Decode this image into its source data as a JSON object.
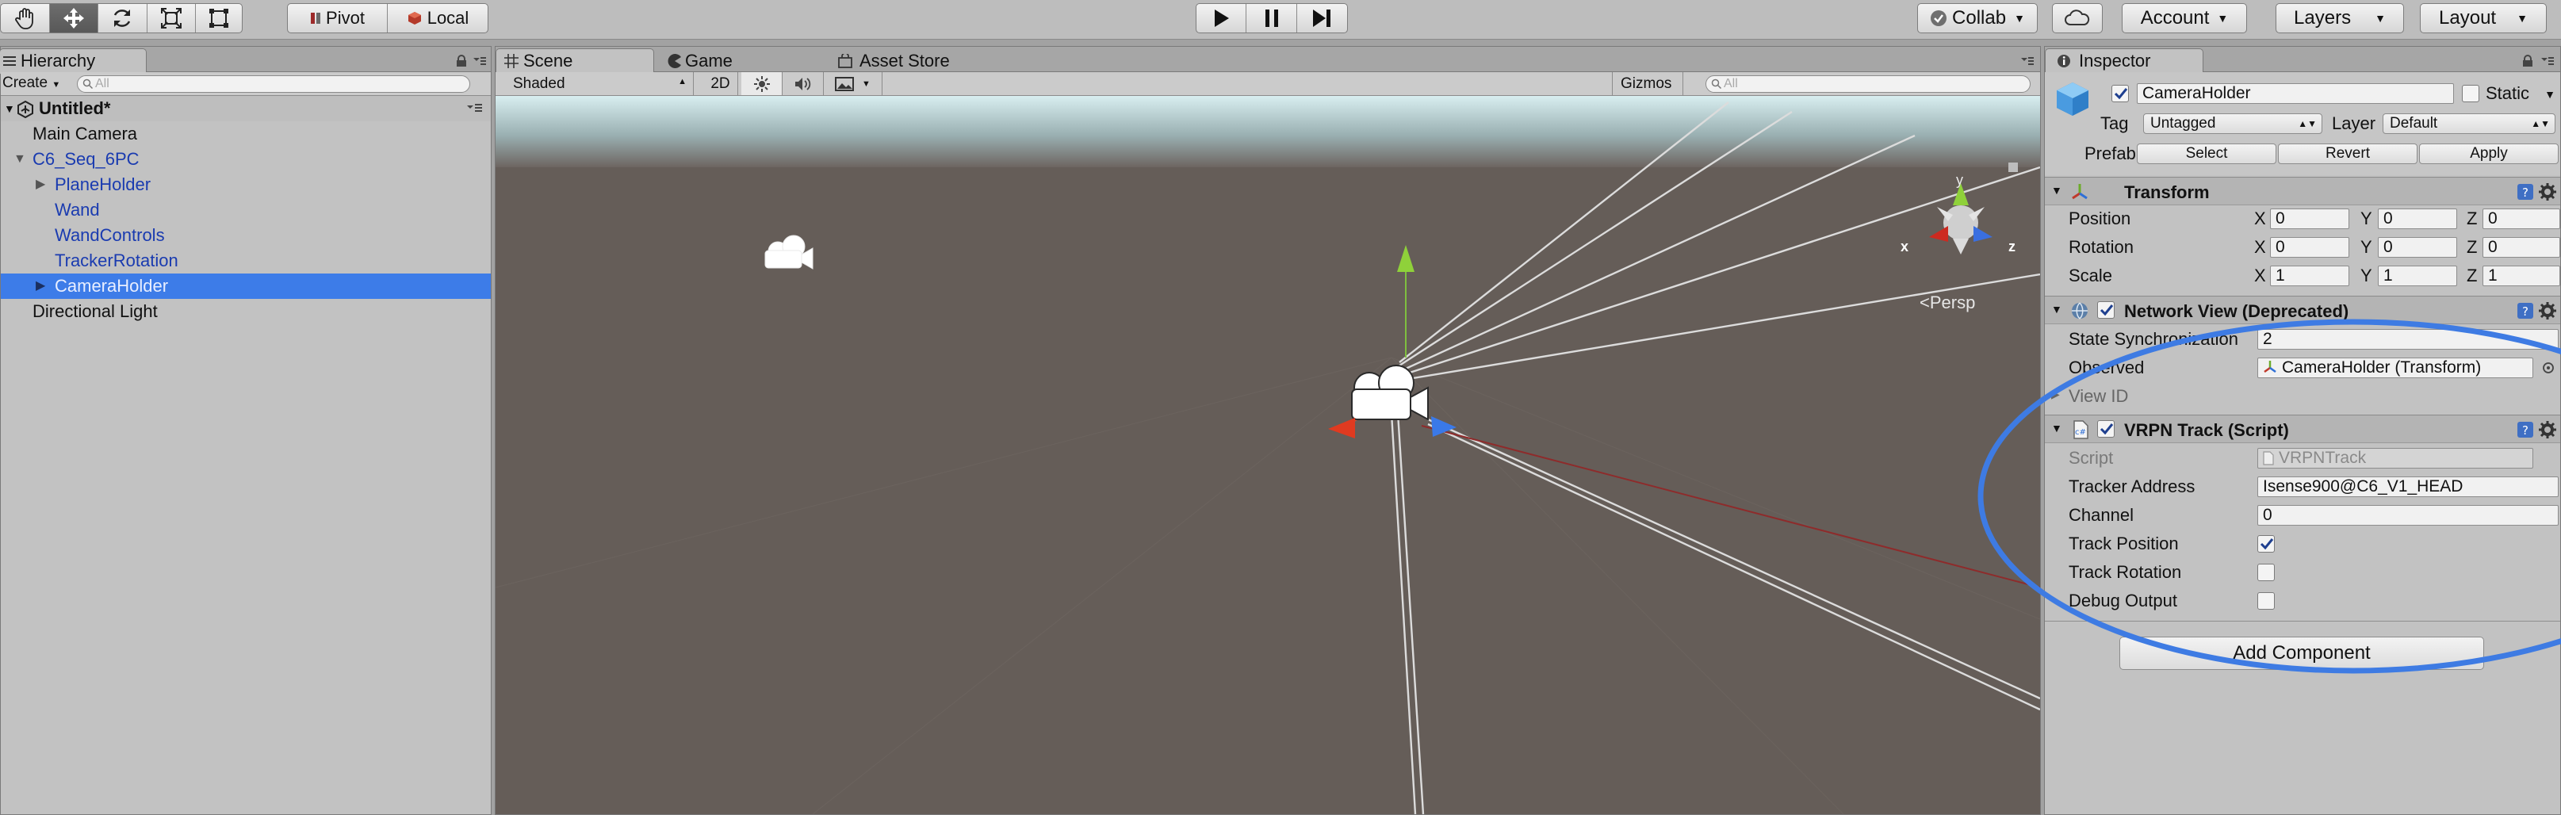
{
  "toolbar": {
    "pivot_label": "Pivot",
    "local_label": "Local",
    "collab_label": "Collab",
    "account_label": "Account",
    "layers_label": "Layers",
    "layout_label": "Layout"
  },
  "hierarchy": {
    "tab_label": "Hierarchy",
    "create_label": "Create",
    "search_placeholder": "All",
    "scene_name": "Untitled*",
    "items": [
      {
        "label": "Main Camera"
      },
      {
        "label": "C6_Seq_6PC"
      },
      {
        "label": "PlaneHolder"
      },
      {
        "label": "Wand"
      },
      {
        "label": "WandControls"
      },
      {
        "label": "TrackerRotation"
      },
      {
        "label": "CameraHolder"
      },
      {
        "label": "Directional Light"
      }
    ],
    "selected": "CameraHolder"
  },
  "scene": {
    "tabs": [
      {
        "label": "Scene"
      },
      {
        "label": "Game"
      },
      {
        "label": "Asset Store"
      }
    ],
    "shading_mode": "Shaded",
    "mode_2d_label": "2D",
    "gizmos_label": "Gizmos",
    "search_placeholder": "All",
    "persp_label": "Persp",
    "axis_x": "x",
    "axis_y": "y",
    "axis_z": "z"
  },
  "inspector": {
    "tab_label": "Inspector",
    "object_name": "CameraHolder",
    "static_label": "Static",
    "tag_label": "Tag",
    "tag_value": "Untagged",
    "layer_label": "Layer",
    "layer_value": "Default",
    "prefab_label": "Prefab",
    "prefab_select": "Select",
    "prefab_revert": "Revert",
    "prefab_apply": "Apply",
    "transform": {
      "title": "Transform",
      "position_label": "Position",
      "rotation_label": "Rotation",
      "scale_label": "Scale",
      "x_label": "X",
      "y_label": "Y",
      "z_label": "Z",
      "position": {
        "x": "0",
        "y": "0",
        "z": "0"
      },
      "rotation": {
        "x": "0",
        "y": "0",
        "z": "0"
      },
      "scale": {
        "x": "1",
        "y": "1",
        "z": "1"
      }
    },
    "network_view": {
      "title": "Network View (Deprecated)",
      "state_sync_label": "State Synchronization",
      "state_sync_value": "2",
      "observed_label": "Observed",
      "observed_value": "CameraHolder (Transform)",
      "view_id_label": "View ID"
    },
    "vrpn": {
      "title": "VRPN Track (Script)",
      "script_label": "Script",
      "script_value": "VRPNTrack",
      "tracker_address_label": "Tracker Address",
      "tracker_address_value": "Isense900@C6_V1_HEAD",
      "channel_label": "Channel",
      "channel_value": "0",
      "track_position_label": "Track Position",
      "track_position_checked": true,
      "track_rotation_label": "Track Rotation",
      "track_rotation_checked": false,
      "debug_output_label": "Debug Output",
      "debug_output_checked": false
    },
    "add_component_label": "Add Component"
  },
  "colors": {
    "selection": "#3d7ce8",
    "annotation_ellipse": "#3e7be3",
    "scene_background": "#655d58",
    "sky": "#d8eef0"
  }
}
